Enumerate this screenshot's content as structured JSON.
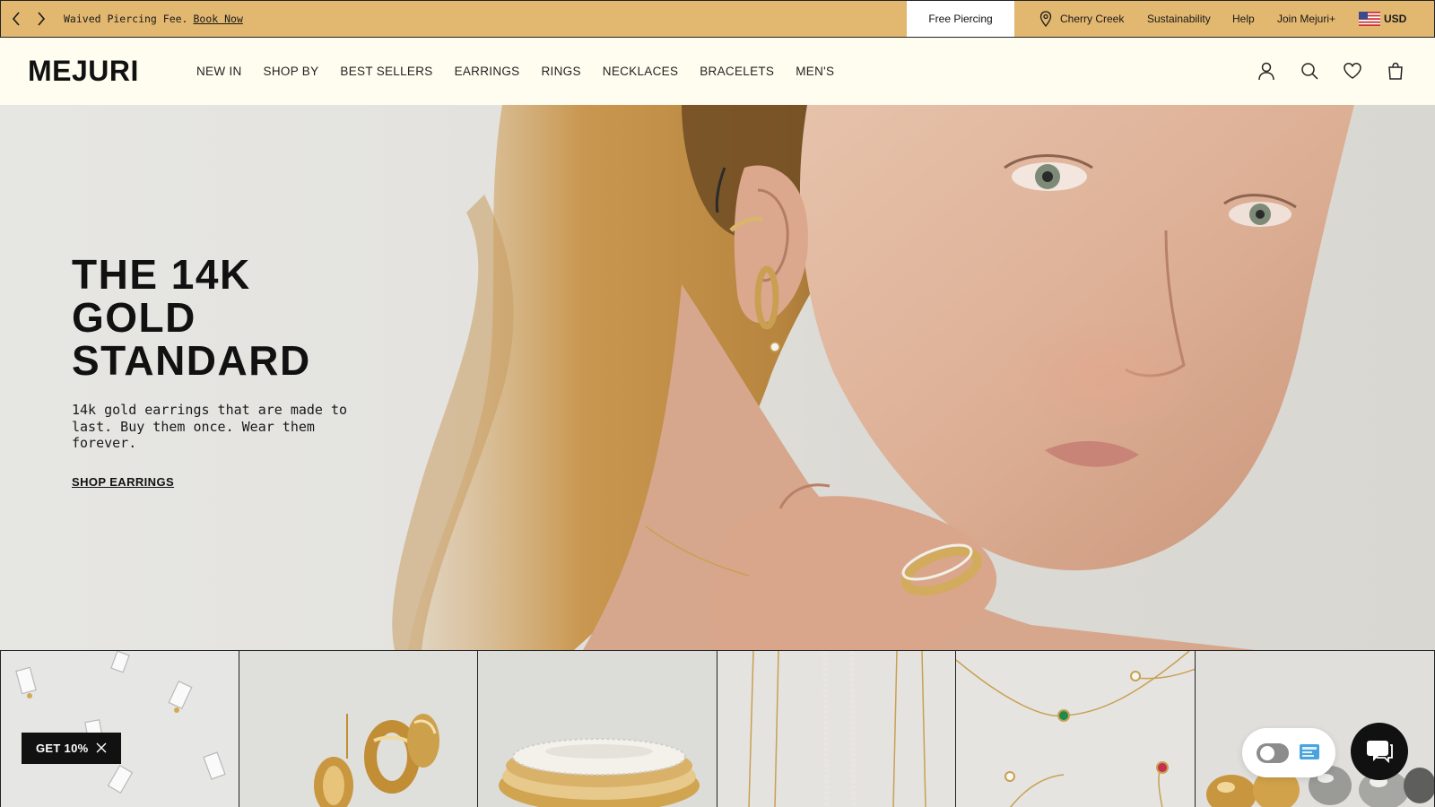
{
  "promo_bar": {
    "message": "Waived Piercing Fee.",
    "link": "Book Now",
    "pill": "Free Piercing",
    "location": "Cherry Creek",
    "sustainability": "Sustainability",
    "help": "Help",
    "join": "Join Mejuri+",
    "currency": "USD"
  },
  "header": {
    "logo": "MEJURI",
    "menu": [
      "NEW IN",
      "SHOP BY",
      "BEST SELLERS",
      "EARRINGS",
      "RINGS",
      "NECKLACES",
      "BRACELETS",
      "MEN'S"
    ],
    "icons": [
      "account-icon",
      "search-icon",
      "heart-icon",
      "bag-icon"
    ]
  },
  "hero": {
    "title": "THE 14K GOLD STANDARD",
    "description": "14k gold earrings that are made to last. Buy them once. Wear them forever.",
    "cta": "SHOP EARRINGS"
  },
  "tiles": [
    {
      "name": "emerald-cut-stud-earrings"
    },
    {
      "name": "gold-dome-hoop-earrings"
    },
    {
      "name": "pave-diamond-stacked-rings"
    },
    {
      "name": "pearl-and-chain-necklaces"
    },
    {
      "name": "gemstone-chain-necklaces"
    },
    {
      "name": "gold-and-silver-dome-earrings"
    }
  ],
  "widgets": {
    "discount_label": "GET 10%"
  },
  "colors": {
    "promo_background": "#e2b76f",
    "header_background": "#fffdf0",
    "text": "#111111"
  }
}
